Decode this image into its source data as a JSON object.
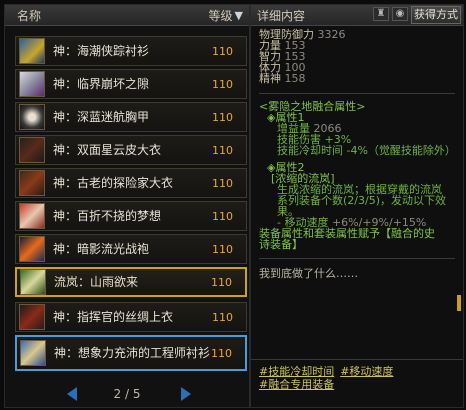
{
  "list": {
    "header_name": "名称",
    "header_level": "等级",
    "items": [
      {
        "name": "神：海潮侠踪衬衫",
        "level": "110",
        "icon": "shirt-icon"
      },
      {
        "name": "神：临界崩坏之隙",
        "level": "110",
        "icon": "shirt-icon"
      },
      {
        "name": "神：深蓝迷航胸甲",
        "level": "110",
        "icon": "breastplate-icon"
      },
      {
        "name": "神：双面星云皮大衣",
        "level": "110",
        "icon": "coat-icon"
      },
      {
        "name": "神：古老的探险家大衣",
        "level": "110",
        "icon": "coat-icon"
      },
      {
        "name": "神：百折不挠的梦想",
        "level": "110",
        "icon": "armor-icon"
      },
      {
        "name": "神：暗影流光战袍",
        "level": "110",
        "icon": "robe-icon"
      },
      {
        "name": "流岚：山雨欲来",
        "level": "110",
        "icon": "cloak-icon"
      },
      {
        "name": "神：指挥官的丝绸上衣",
        "level": "110",
        "icon": "shirt-icon"
      },
      {
        "name": "神：想象力充沛的工程师衬衫",
        "level": "110",
        "icon": "shirt-icon"
      }
    ],
    "page": "2 / 5"
  },
  "detail": {
    "header": "详细内容",
    "obtain_button": "获得方式",
    "stats": [
      {
        "label": "物理防御力",
        "value": "3326"
      },
      {
        "label": "力量",
        "value": "153"
      },
      {
        "label": "智力",
        "value": "153"
      },
      {
        "label": "体力",
        "value": "100"
      },
      {
        "label": "精神",
        "value": "158"
      }
    ],
    "set_title": "<雾隐之地融合属性>",
    "attr1_title": "属性1",
    "attr1_lines": [
      {
        "label": "增益量",
        "value": "2066"
      },
      {
        "label": "技能伤害",
        "value": "+3%"
      },
      {
        "label": "技能冷却时间",
        "value": "-4%（觉醒技能除外）"
      }
    ],
    "attr2_title": "属性2",
    "attr2_sub": "[浓缩的流岚]",
    "attr2_desc": [
      "生成浓缩的流岚；根据穿戴的流岚",
      "系列装备个数(2/3/5)，发动以下效",
      "果。"
    ],
    "attr2_speed": {
      "label": "- 移动速度",
      "value": "+6%/+9%/+15%"
    },
    "fusion_note": [
      "装备属性和套装属性赋予【融合的史",
      "诗装备】"
    ],
    "flavor": "我到底做了什么……",
    "tags": [
      "#技能冷却时间",
      "#移动速度",
      "#融合专用装备"
    ]
  }
}
